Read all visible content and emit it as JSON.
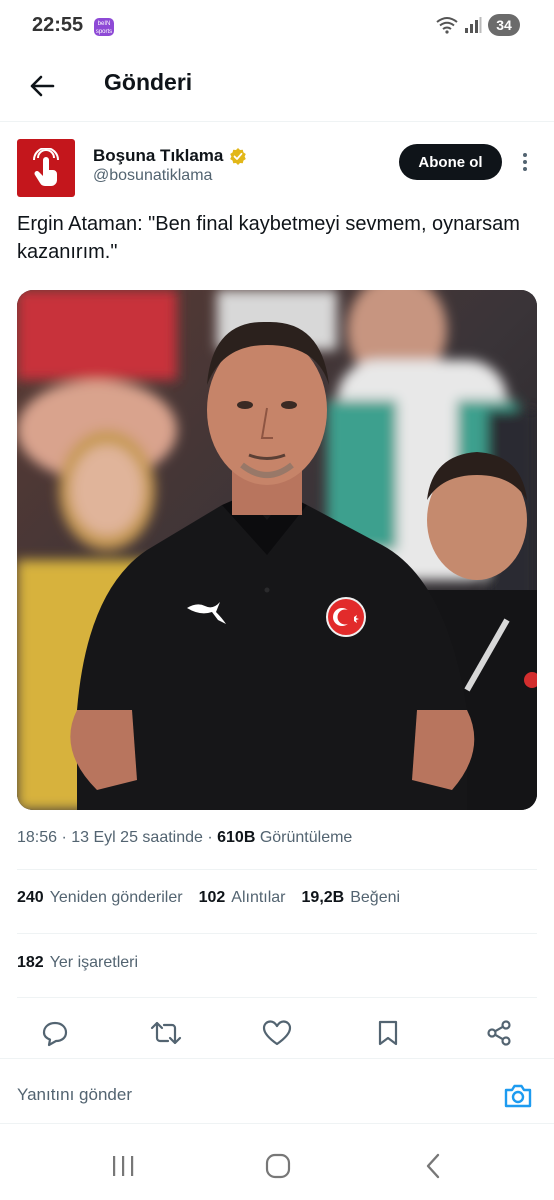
{
  "status_bar": {
    "time": "22:55",
    "app_label": "beIN sports",
    "battery": "34"
  },
  "header": {
    "title": "Gönderi"
  },
  "author": {
    "name": "Boşuna Tıklama",
    "handle": "@bosunatiklama",
    "follow_label": "Abone ol"
  },
  "tweet": {
    "text": "Ergin Ataman: \"Ben final kaybetmeyi sevmem, oynarsam kazanırım.\"",
    "time": "18:56 · 13 Eyl 25 saatinde · ",
    "views_count": "610B",
    "views_label": " Görüntüleme"
  },
  "stats": {
    "reposts": {
      "count": "240",
      "label": "Yeniden gönderiler"
    },
    "quotes": {
      "count": "102",
      "label": "Alıntılar"
    },
    "likes": {
      "count": "19,2B",
      "label": "Beğeni"
    },
    "bookmarks": {
      "count": "182",
      "label": "Yer işaretleri"
    }
  },
  "reply": {
    "placeholder": "Yanıtını gönder"
  },
  "colors": {
    "accent": "#1d9bf0",
    "avatar_red": "#c4161c",
    "text_secondary": "#536471"
  }
}
